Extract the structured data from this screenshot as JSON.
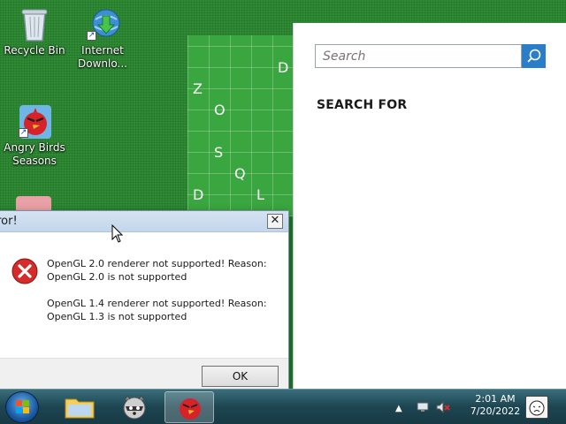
{
  "desktop": {
    "icons": [
      {
        "label": "Recycle Bin",
        "icon": "recycle-bin-icon"
      },
      {
        "label": "Internet Downlo...",
        "icon": "internet-download-manager-icon"
      },
      {
        "label": "Angry Birds Seasons",
        "icon": "angry-birds-icon"
      }
    ]
  },
  "board": {
    "letters": [
      "D",
      "Z",
      "O",
      "S",
      "Q",
      "D",
      "L"
    ]
  },
  "search_pane": {
    "placeholder": "Search",
    "heading": "SEARCH FOR"
  },
  "dialog": {
    "title": "rror!",
    "close_label": "✕",
    "message1_line1": "OpenGL 2.0 renderer not supported! Reason:",
    "message1_line2": "OpenGL 2.0 is not supported",
    "message2_line1": "OpenGL 1.4 renderer not supported! Reason:",
    "message2_line2": "OpenGL 1.3 is not supported",
    "ok_label": "OK"
  },
  "taskbar": {
    "items": [
      "start-orb",
      "file-explorer-icon",
      "raccoon-app-icon",
      "angry-birds-taskbar-icon"
    ],
    "clock_time": "2:01 AM",
    "clock_date": "7/20/2022"
  }
}
